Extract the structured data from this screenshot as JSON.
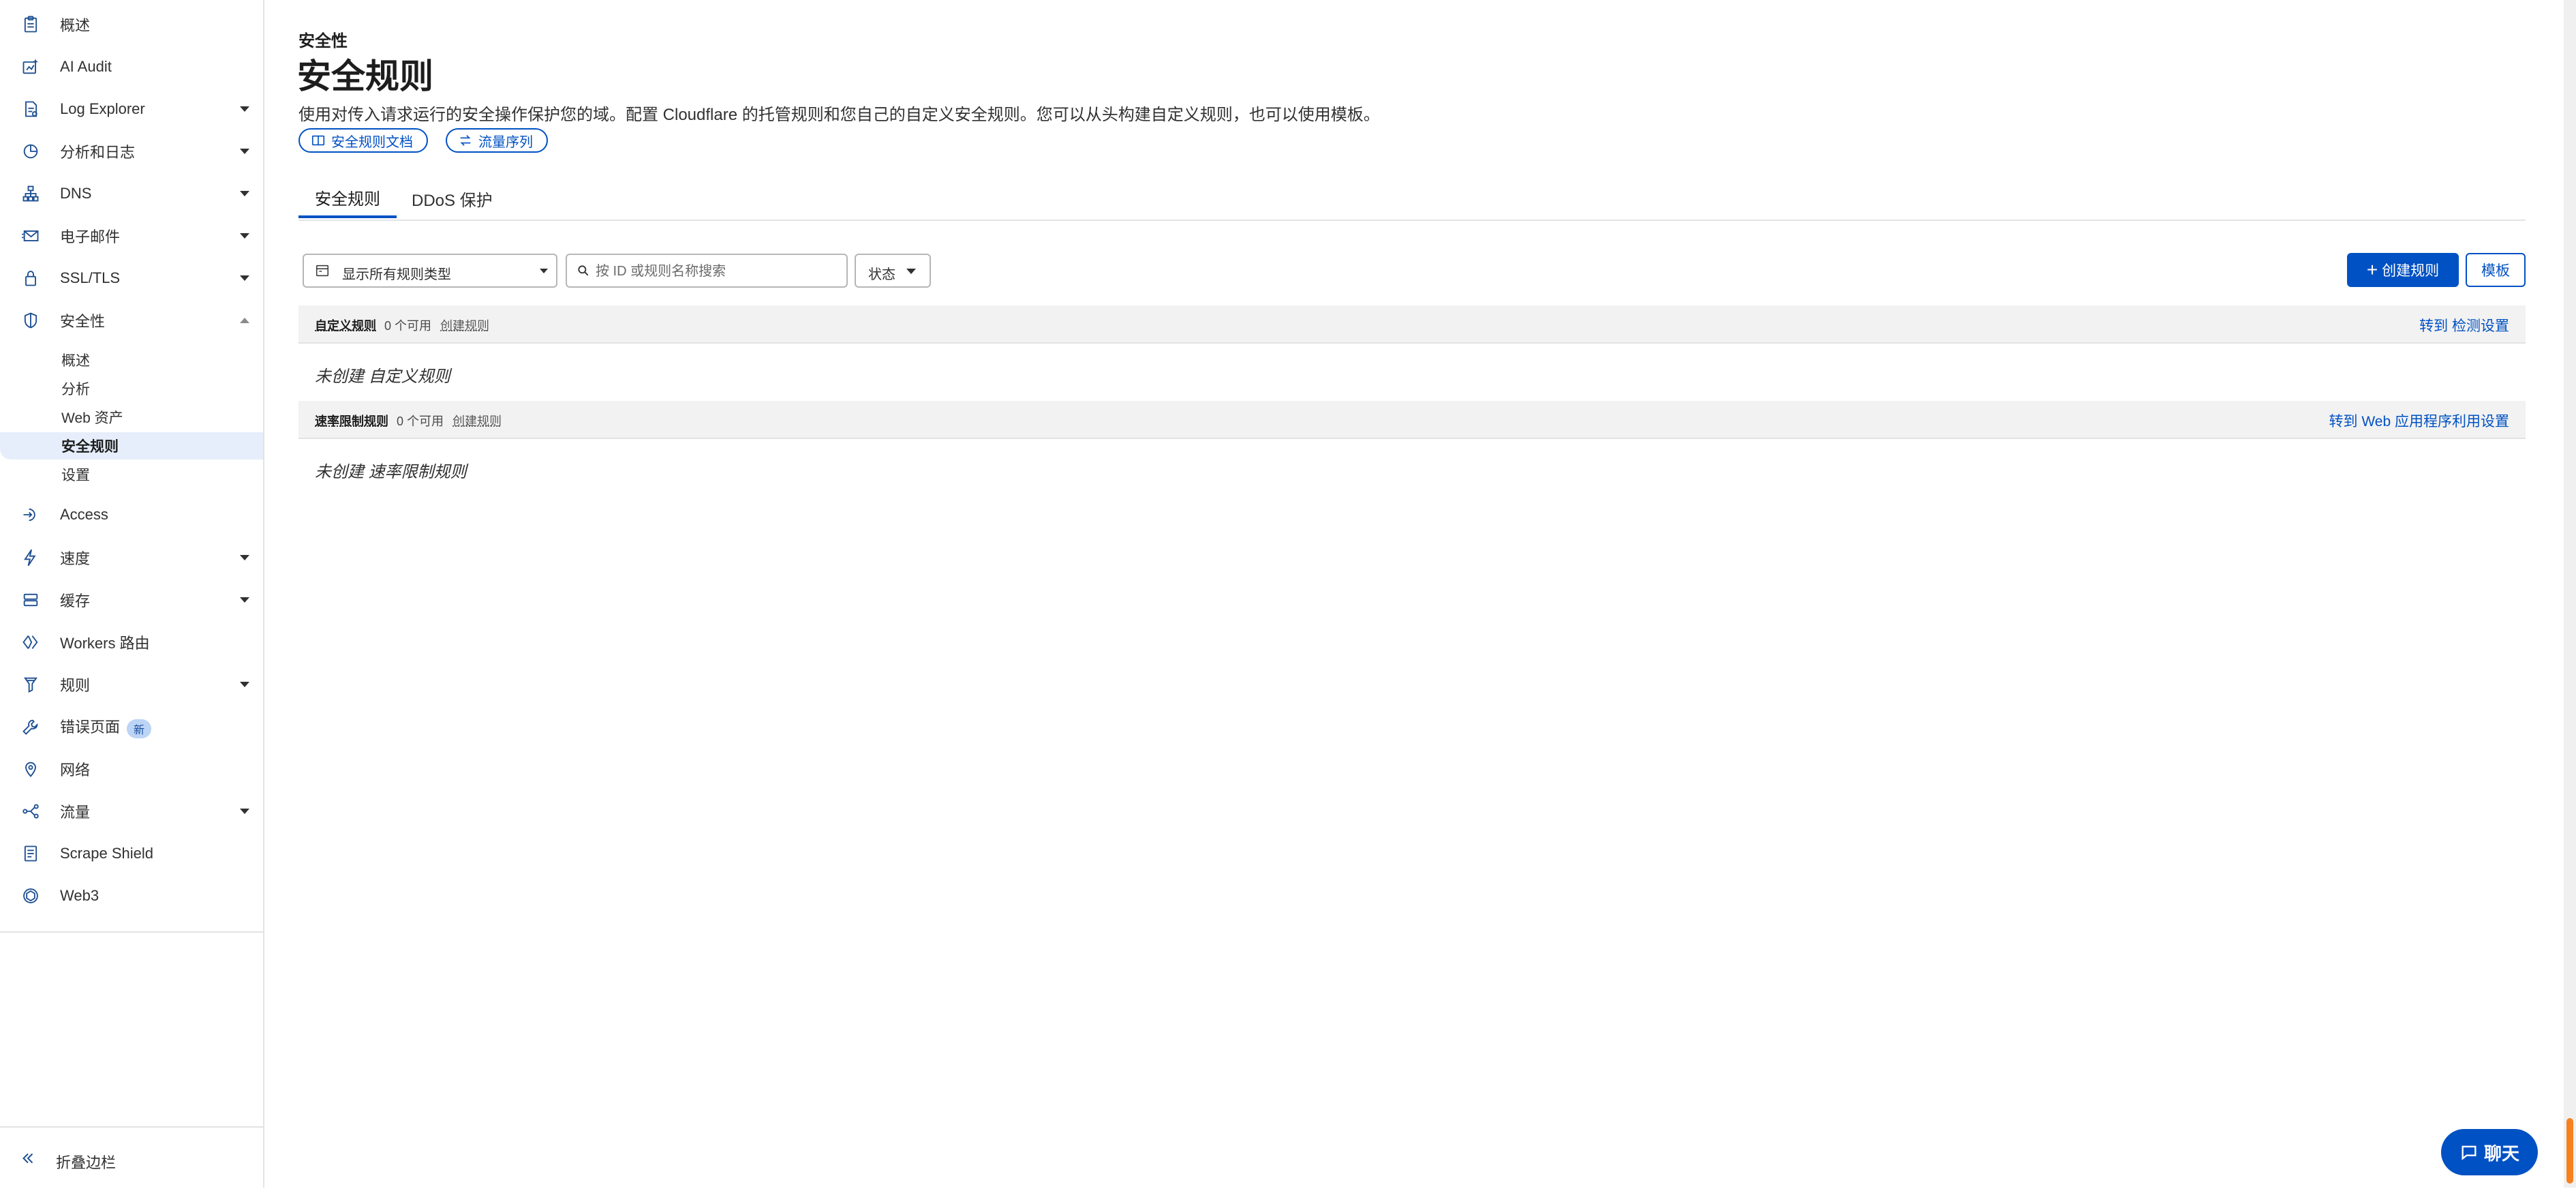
{
  "sidebar": {
    "items": [
      {
        "label": "概述",
        "icon": "clipboard-icon"
      },
      {
        "label": "AI Audit",
        "icon": "ai-audit-icon"
      },
      {
        "label": "Log Explorer",
        "icon": "log-explorer-icon"
      },
      {
        "label": "分析和日志",
        "icon": "analytics-icon"
      },
      {
        "label": "DNS",
        "icon": "dns-icon"
      },
      {
        "label": "电子邮件",
        "icon": "email-icon"
      },
      {
        "label": "SSL/TLS",
        "icon": "lock-icon"
      },
      {
        "label": "安全性",
        "icon": "shield-icon"
      }
    ],
    "security_subitems": [
      {
        "label": "概述"
      },
      {
        "label": "分析"
      },
      {
        "label": "Web 资产"
      },
      {
        "label": "安全规则"
      },
      {
        "label": "设置"
      }
    ],
    "items_after": [
      {
        "label": "Access",
        "icon": "access-icon"
      },
      {
        "label": "速度",
        "icon": "lightning-icon"
      },
      {
        "label": "缓存",
        "icon": "cache-icon"
      },
      {
        "label": "Workers 路由",
        "icon": "workers-icon"
      },
      {
        "label": "规则",
        "icon": "rules-icon"
      },
      {
        "label": "错误页面",
        "icon": "wrench-icon",
        "badge": "新"
      },
      {
        "label": "网络",
        "icon": "location-pin-icon"
      },
      {
        "label": "流量",
        "icon": "traffic-icon"
      },
      {
        "label": "Scrape Shield",
        "icon": "scrape-shield-icon"
      },
      {
        "label": "Web3",
        "icon": "web3-icon"
      }
    ],
    "collapse_label": "折叠边栏"
  },
  "header": {
    "eyebrow": "安全性",
    "title": "安全规则",
    "description": "使用对传入请求运行的安全操作保护您的域。配置 Cloudflare 的托管规则和您自己的自定义安全规则。您可以从头构建自定义规则，也可以使用模板。",
    "links": [
      {
        "label": "安全规则文档",
        "icon": "book-icon"
      },
      {
        "label": "流量序列",
        "icon": "arrows-swap-icon"
      }
    ]
  },
  "tabs": [
    {
      "label": "安全规则",
      "active": true
    },
    {
      "label": "DDoS 保护",
      "active": false
    }
  ],
  "toolbar": {
    "filter_label": "显示所有规则类型",
    "search_placeholder": "按 ID 或规则名称搜索",
    "status_label": "状态",
    "create_label": "创建规则",
    "template_label": "模板"
  },
  "sections": [
    {
      "title": "自定义规则",
      "count": "0 个可用",
      "create_link": "创建规则",
      "right_link": "转到 检测设置",
      "empty_text": "未创建 自定义规则"
    },
    {
      "title": "速率限制规则",
      "count": "0 个可用",
      "create_link": "创建规则",
      "right_link": "转到 Web 应用程序利用设置",
      "empty_text": "未创建 速率限制规则"
    }
  ],
  "chat": {
    "label": "聊天"
  },
  "colors": {
    "accent": "#0051c3",
    "scroll_thumb": "#f6821f",
    "active_nav_bg": "#e6eefb"
  }
}
